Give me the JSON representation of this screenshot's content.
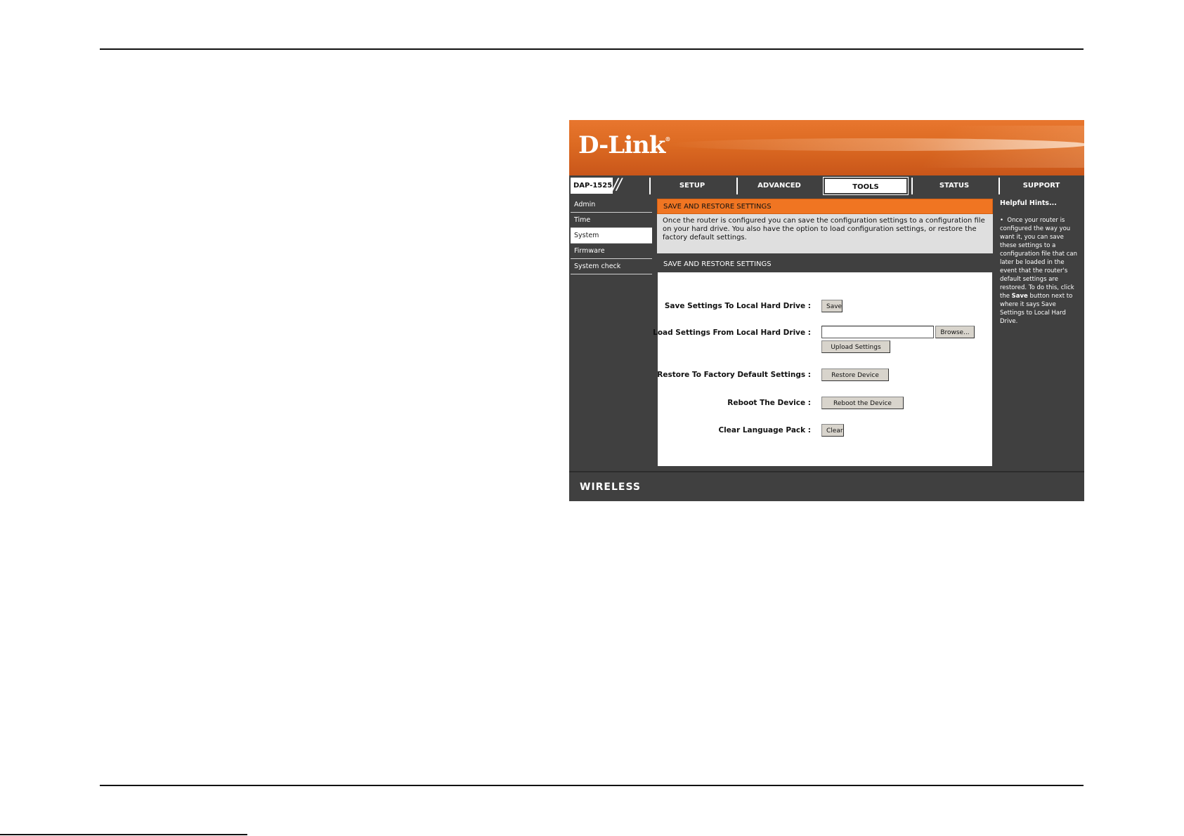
{
  "brand": {
    "logo": "D-Link",
    "logo_mark": "®",
    "model": "DAP-1525"
  },
  "nav_tabs": [
    {
      "label": "SETUP"
    },
    {
      "label": "ADVANCED"
    },
    {
      "label": "TOOLS",
      "active": true
    },
    {
      "label": "STATUS"
    },
    {
      "label": "SUPPORT"
    }
  ],
  "sidebar": {
    "items": [
      {
        "label": "Admin"
      },
      {
        "label": "Time"
      },
      {
        "label": "System",
        "active": true
      },
      {
        "label": "Firmware"
      },
      {
        "label": "System check"
      }
    ]
  },
  "intro": {
    "title": "SAVE AND RESTORE SETTINGS",
    "text": "Once the router is configured you can save the configuration settings to a configuration file on your hard drive. You also have the option to load configuration settings, or restore the factory default settings."
  },
  "settings": {
    "title": "SAVE AND RESTORE SETTINGS",
    "save_label": "Save Settings To Local Hard Drive :",
    "save_button": "Save",
    "load_label": "Load Settings From Local Hard Drive :",
    "file_value": "",
    "browse_button": "Browse...",
    "upload_button": "Upload Settings",
    "restore_label": "Restore To Factory Default Settings :",
    "restore_button": "Restore Device",
    "reboot_label": "Reboot The Device :",
    "reboot_button": "Reboot the Device",
    "clear_label": "Clear Language Pack :",
    "clear_button": "Clear"
  },
  "hints": {
    "title": "Helpful Hints...",
    "bullet": "•",
    "text_before": "Once your router is configured the way you want it, you can save these settings to a configuration file that can later be loaded in the event that the router's default settings are restored. To do this, click the ",
    "emphasis": "Save",
    "text_after": " button next to where it says Save Settings to Local Hard Drive."
  },
  "footer": {
    "wireless": "WIRELESS"
  },
  "colors": {
    "orange": "#f07522",
    "dark": "#404040"
  }
}
